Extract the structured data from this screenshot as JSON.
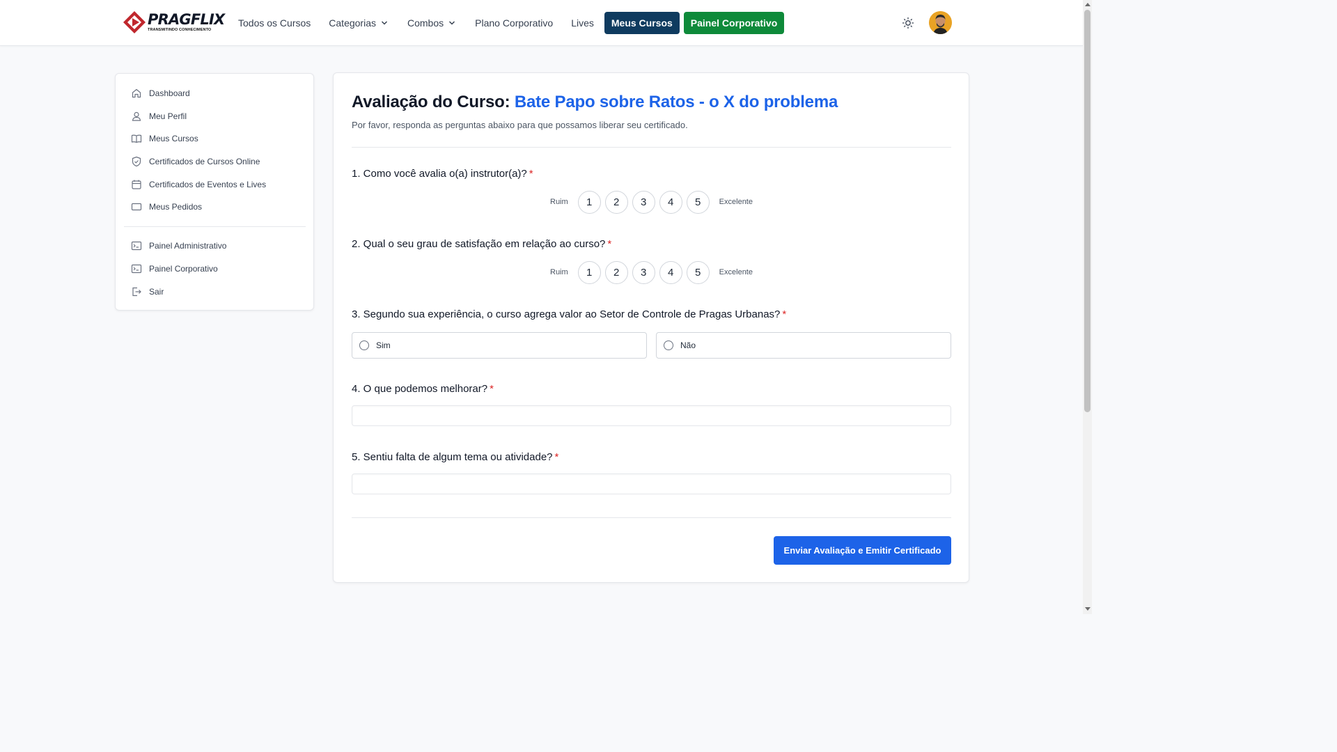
{
  "header": {
    "logo_text": "PRAGFLIX",
    "logo_tagline": "TRANSMITINDO CONHECIMENTO",
    "nav": {
      "all_courses": "Todos os Cursos",
      "categories": "Categorias",
      "combos": "Combos",
      "corporate_plan": "Plano Corporativo",
      "lives": "Lives",
      "my_courses": "Meus Cursos",
      "corporate_panel": "Painel Corporativo"
    },
    "colors": {
      "my_courses_bg": "#0f3b5f",
      "corporate_panel_bg": "#0e8a3a"
    }
  },
  "sidebar": {
    "items": [
      {
        "label": "Dashboard",
        "icon": "home-icon"
      },
      {
        "label": "Meu Perfil",
        "icon": "user-icon"
      },
      {
        "label": "Meus Cursos",
        "icon": "book-icon"
      },
      {
        "label": "Certificados de Cursos Online",
        "icon": "shield-icon"
      },
      {
        "label": "Certificados de Eventos e Lives",
        "icon": "calendar-icon"
      },
      {
        "label": "Meus Pedidos",
        "icon": "card-icon"
      }
    ],
    "admin_items": [
      {
        "label": "Painel Administrativo",
        "icon": "terminal-icon"
      },
      {
        "label": "Painel Corporativo",
        "icon": "terminal-icon"
      },
      {
        "label": "Sair",
        "icon": "logout-icon"
      }
    ]
  },
  "main": {
    "title_prefix": "Avaliação do Curso:",
    "course_name": "Bate Papo sobre Ratos - o X do problema",
    "subtitle": "Por favor, responda as perguntas abaixo para que possamos liberar seu certificado.",
    "required_mark": "*",
    "scale_low": "Ruim",
    "scale_high": "Excelente",
    "scale_values": [
      "1",
      "2",
      "3",
      "4",
      "5"
    ],
    "questions": [
      {
        "label": "1. Como você avalia o(a) instrutor(a)?"
      },
      {
        "label": "2. Qual o seu grau de satisfação em relação ao curso?"
      },
      {
        "label": "3. Segundo sua experiência, o curso agrega valor ao Setor de Controle de Pragas Urbanas?",
        "options": [
          "Sim",
          "Não"
        ]
      },
      {
        "label": "4. O que podemos melhorar?",
        "value": ""
      },
      {
        "label": "5. Sentiu falta de algum tema ou atividade?",
        "value": ""
      }
    ],
    "submit_label": "Enviar Avaliação e Emitir Certificado",
    "accent_color": "#1d63e8"
  }
}
